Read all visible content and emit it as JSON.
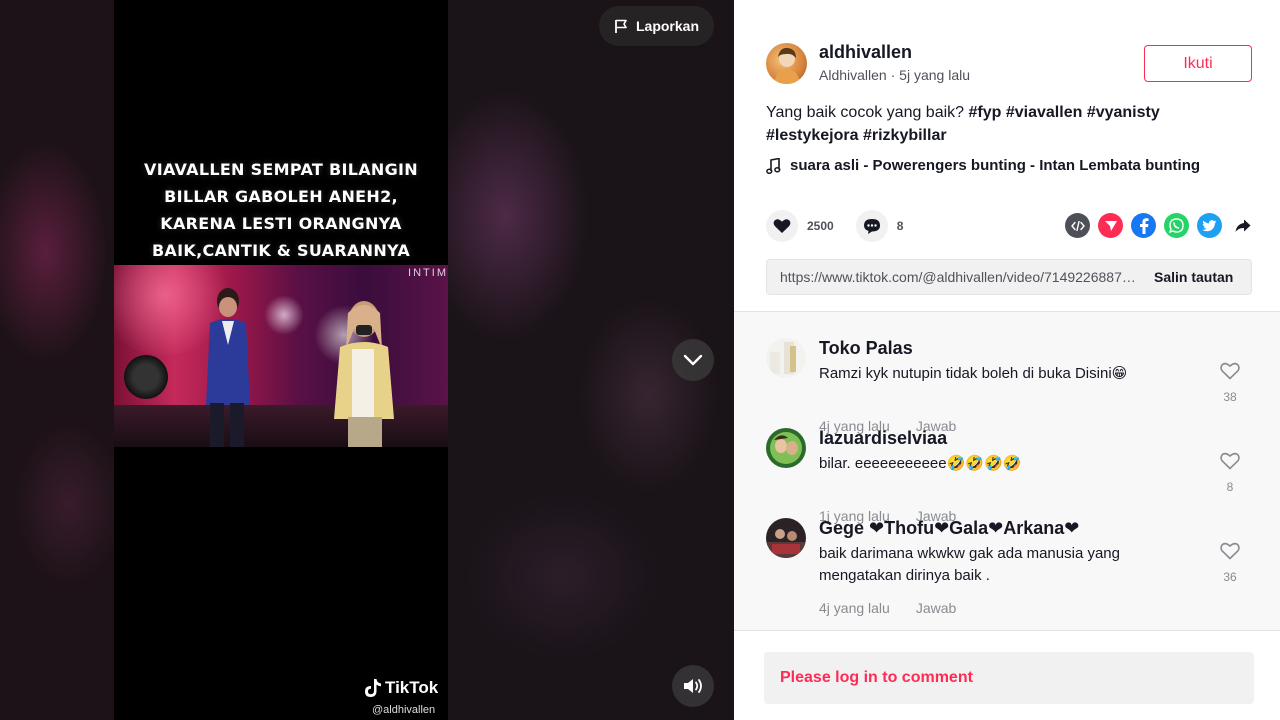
{
  "video": {
    "caption_overlay": "VIAVALLEN SEMPAT BILANGIN BILLAR GABOLEH ANEH2, KARENA LESTI ORANGNYA BAIK,CANTIK & SUARANNYA BAGUS🥺✨",
    "stage_text": "INTIM",
    "watermark": "TikTok",
    "watermark_handle": "@aldhivallen",
    "report_label": "Laporkan"
  },
  "author": {
    "username": "aldhivallen",
    "nickname": "Aldhivallen",
    "time": "5j yang lalu",
    "separator": " · ",
    "follow_label": "Ikuti"
  },
  "description": {
    "text": "Yang baik cocok yang baik? ",
    "hashtags": [
      "#fyp",
      "#viavallen",
      "#vyanisty",
      "#lestykejora",
      "#rizkybillar"
    ]
  },
  "music": "suara asli - Powerengers bunting - Intan Lembata bunting",
  "stats": {
    "likes": "2500",
    "comments": "8"
  },
  "share": {
    "icons": [
      "embed-icon",
      "send-icon",
      "facebook-icon",
      "whatsapp-icon",
      "twitter-icon",
      "share-arrow-icon"
    ],
    "link": "https://www.tiktok.com/@aldhivallen/video/7149226887147408667",
    "copy_label": "Salin tautan"
  },
  "comments": [
    {
      "name": "Toko Palas",
      "text": "Ramzi kyk nutupin tidak boleh di buka Disini😁",
      "time": "4j yang lalu",
      "reply": "Jawab",
      "likes": "38"
    },
    {
      "name": "lazuardiselviaa",
      "text": "bilar. eeeeeeeeeee🤣🤣🤣🤣",
      "time": "1j yang lalu",
      "reply": "Jawab",
      "likes": "8"
    },
    {
      "name": "Gege ❤Thofu❤Gala❤Arkana❤",
      "text": "baik darimana wkwkw gak ada manusia yang mengatakan dirinya baik .",
      "time": "4j yang lalu",
      "reply": "Jawab",
      "likes": "36"
    }
  ],
  "login_prompt": "Please log in to comment",
  "colors": {
    "accent": "#fe2c55",
    "text": "#161823",
    "muted": "#8a8b91"
  }
}
